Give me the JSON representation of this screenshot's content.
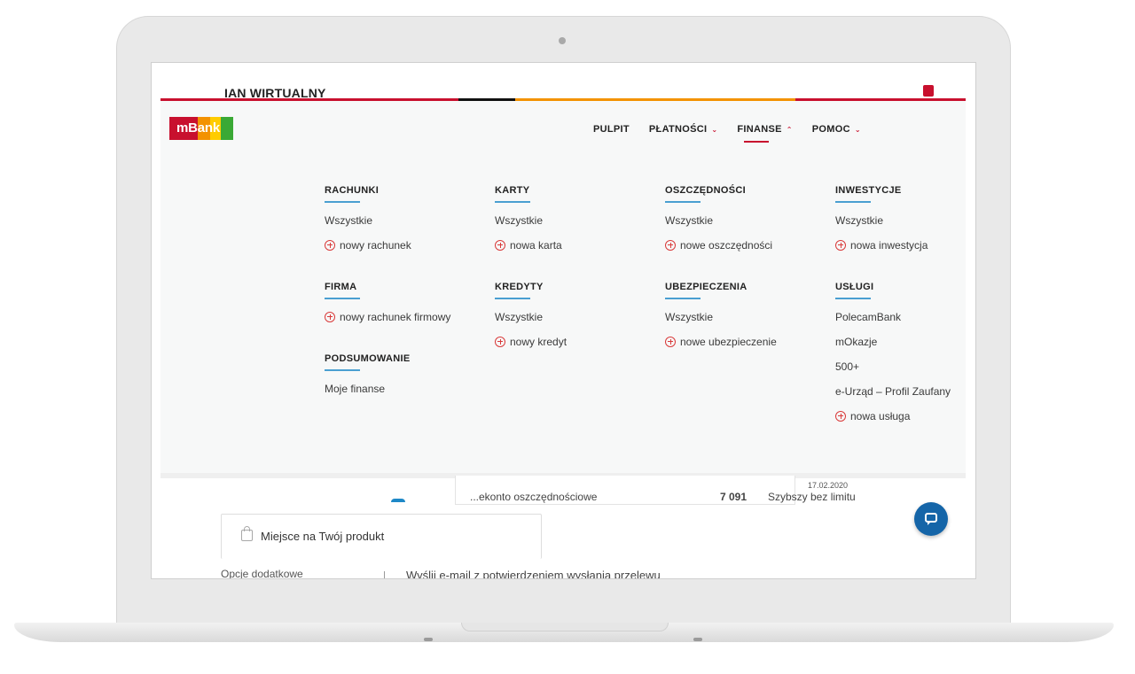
{
  "app": {
    "title": "IAN WIRTUALNY"
  },
  "brand": {
    "logo_text": "mBank",
    "stripe_colors": [
      "#c8102e",
      "#111111",
      "#f39200",
      "#c8102e"
    ],
    "logo_colors": [
      "#c8102e",
      "#f39200",
      "#ffcc00",
      "#3aa935"
    ]
  },
  "nav": {
    "items": [
      {
        "label": "PULPIT",
        "has_menu": false,
        "active": false
      },
      {
        "label": "PŁATNOŚCI",
        "has_menu": true,
        "active": false,
        "chevron": "⌄"
      },
      {
        "label": "FINANSE",
        "has_menu": true,
        "active": true,
        "chevron": "⌃"
      },
      {
        "label": "POMOC",
        "has_menu": true,
        "active": false,
        "chevron": "⌄"
      }
    ]
  },
  "menu": {
    "sections": [
      {
        "title": "RACHUNKI",
        "links": [
          {
            "label": "Wszystkie",
            "icon": ""
          },
          {
            "label": "nowy rachunek",
            "icon": "plus-circle-icon"
          }
        ]
      },
      {
        "title": "KARTY",
        "links": [
          {
            "label": "Wszystkie",
            "icon": ""
          },
          {
            "label": "nowa karta",
            "icon": "plus-circle-icon"
          }
        ]
      },
      {
        "title": "OSZCZĘDNOŚCI",
        "links": [
          {
            "label": "Wszystkie",
            "icon": ""
          },
          {
            "label": "nowe oszczędności",
            "icon": "plus-circle-icon"
          }
        ]
      },
      {
        "title": "INWESTYCJE",
        "links": [
          {
            "label": "Wszystkie",
            "icon": ""
          },
          {
            "label": "nowa inwestycja",
            "icon": "plus-circle-icon"
          }
        ]
      },
      {
        "title": "FIRMA",
        "links": [
          {
            "label": "nowy rachunek firmowy",
            "icon": "plus-circle-icon"
          }
        ]
      },
      {
        "title": "KREDYTY",
        "links": [
          {
            "label": "Wszystkie",
            "icon": ""
          },
          {
            "label": "nowy kredyt",
            "icon": "plus-circle-icon"
          }
        ]
      },
      {
        "title": "UBEZPIECZENIA",
        "links": [
          {
            "label": "Wszystkie",
            "icon": ""
          },
          {
            "label": "nowe ubezpieczenie",
            "icon": "plus-circle-icon"
          }
        ]
      },
      {
        "title": "USŁUGI",
        "links": [
          {
            "label": "PolecamBank",
            "icon": ""
          },
          {
            "label": "mOkazje",
            "icon": ""
          },
          {
            "label": "500+",
            "icon": ""
          },
          {
            "label": "e-Urząd – Profil Zaufany",
            "icon": ""
          },
          {
            "label": "nowa usługa",
            "icon": "plus-circle-icon"
          }
        ]
      },
      {
        "title": "PODSUMOWANIE",
        "links": [
          {
            "label": "Moje finanse",
            "icon": ""
          }
        ]
      }
    ]
  },
  "page": {
    "account_text": "...ekonto oszczędnościowe",
    "amount_text": "7 091",
    "limit_text": "Szybszy bez limitu",
    "date": "17.02.2020",
    "product_placeholder": "Miejsce na Twój produkt",
    "options_label": "Opcje dodatkowe",
    "email_option": "Wyślij e-mail z potwierdzeniem wysłania przelewu"
  },
  "chat": {
    "icon": "chat-icon"
  }
}
